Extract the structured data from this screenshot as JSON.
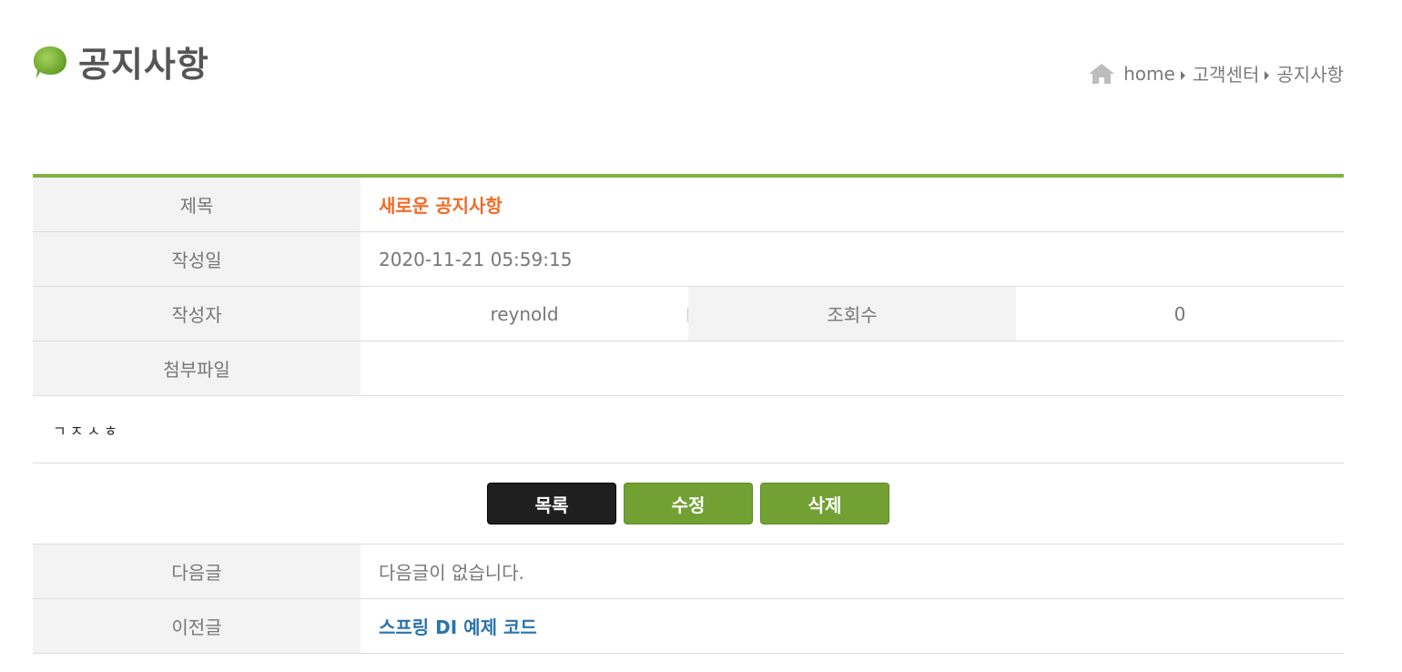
{
  "header": {
    "title": "공지사항",
    "breadcrumb": {
      "home": "home",
      "level1": "고객센터",
      "level2": "공지사항"
    }
  },
  "detail": {
    "subject_label": "제목",
    "subject_value": "새로운 공지사항",
    "date_label": "작성일",
    "date_value": "2020-11-21 05:59:15",
    "writer_label": "작성자",
    "writer_value": "reynold",
    "views_label": "조회수",
    "views_value": "0",
    "attachment_label": "첨부파일",
    "attachment_value": "",
    "content": "ㄱㅈㅅㅎ"
  },
  "buttons": {
    "list": "목록",
    "edit": "수정",
    "delete": "삭제"
  },
  "navigation": {
    "next_label": "다음글",
    "next_value": "다음글이 없습니다.",
    "prev_label": "이전글",
    "prev_value": "스프링 DI 예제 코드"
  },
  "colors": {
    "accent_green": "#7fb23f",
    "title_orange": "#f26a24",
    "link_blue": "#2b73ad"
  }
}
